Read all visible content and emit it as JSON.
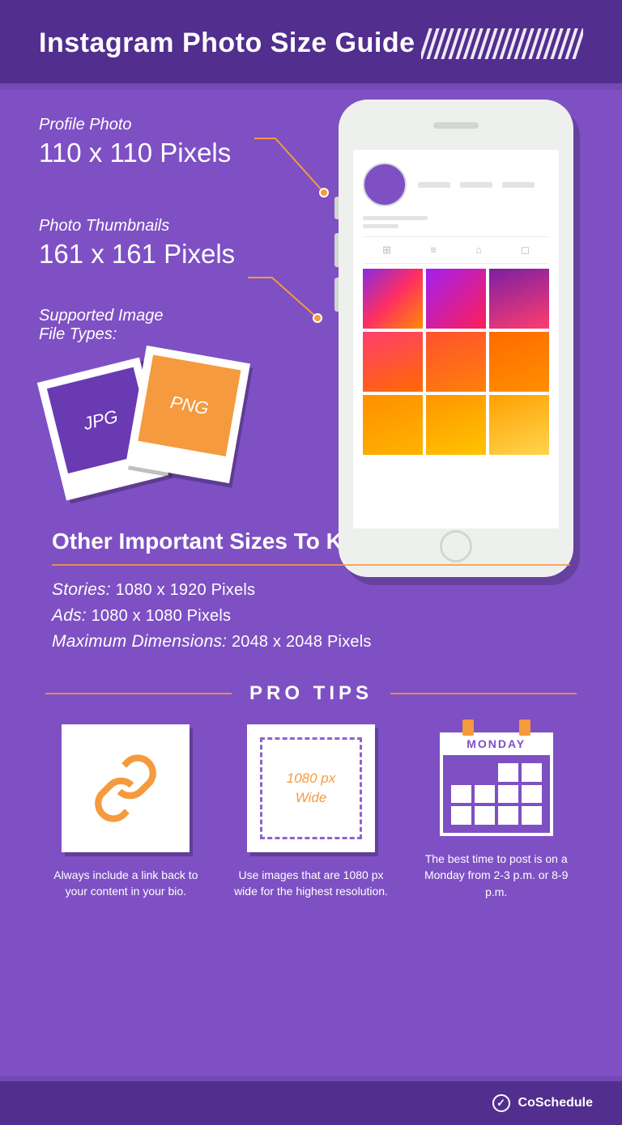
{
  "header": {
    "title": "Instagram Photo Size Guide"
  },
  "spec": {
    "profile": {
      "label": "Profile Photo",
      "value": "110 x 110 Pixels"
    },
    "thumb": {
      "label": "Photo Thumbnails",
      "value": "161 x 161 Pixels"
    },
    "filetypes": {
      "label": "Supported Image\nFile Types:",
      "jpg": "JPG",
      "png": "PNG"
    }
  },
  "other": {
    "heading": "Other Important Sizes To Know",
    "rows": {
      "stories": {
        "label": "Stories:",
        "value": "1080 x 1920 Pixels"
      },
      "ads": {
        "label": "Ads:",
        "value": "1080 x 1080 Pixels"
      },
      "max": {
        "label": "Maximum Dimensions:",
        "value": "2048 x 2048 Pixels"
      }
    }
  },
  "protips": {
    "heading": "PRO TIPS",
    "tip1": {
      "text": "Always include a link back to your content in your bio."
    },
    "tip2": {
      "card": "1080 px\nWide",
      "text": "Use images that are 1080 px wide for the highest resolution."
    },
    "tip3": {
      "day": "MONDAY",
      "text": "The best time to post is on a Monday from 2-3 p.m. or 8-9 p.m."
    }
  },
  "footer": {
    "brand": "CoSchedule"
  }
}
